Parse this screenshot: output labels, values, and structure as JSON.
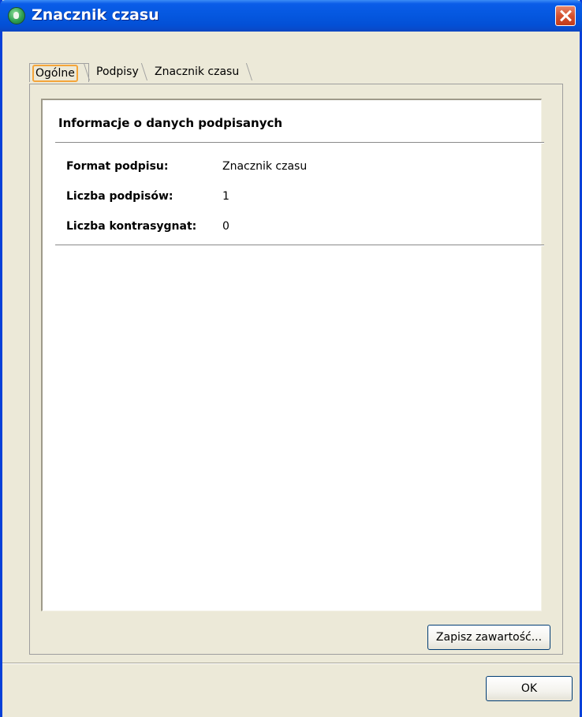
{
  "window": {
    "title": "Znacznik czasu",
    "icon": "app-globe-icon",
    "close_icon": "close-icon"
  },
  "tabs": [
    {
      "label": "Ogólne",
      "selected": true
    },
    {
      "label": "Podpisy",
      "selected": false
    },
    {
      "label": "Znacznik czasu",
      "selected": false
    }
  ],
  "info": {
    "title": "Informacje o danych podpisanych",
    "rows": [
      {
        "label": "Format podpisu:",
        "value": "Znacznik czasu"
      },
      {
        "label": "Liczba podpisów:",
        "value": "1"
      },
      {
        "label": "Liczba kontrasygnat:",
        "value": "0"
      }
    ]
  },
  "buttons": {
    "save": "Zapisz zawartość...",
    "ok": "OK"
  },
  "colors": {
    "title_bar": "#0558e0",
    "window_bg": "#ece9d8",
    "tab_focus": "#f4a53a",
    "close_button": "#d5512e"
  }
}
